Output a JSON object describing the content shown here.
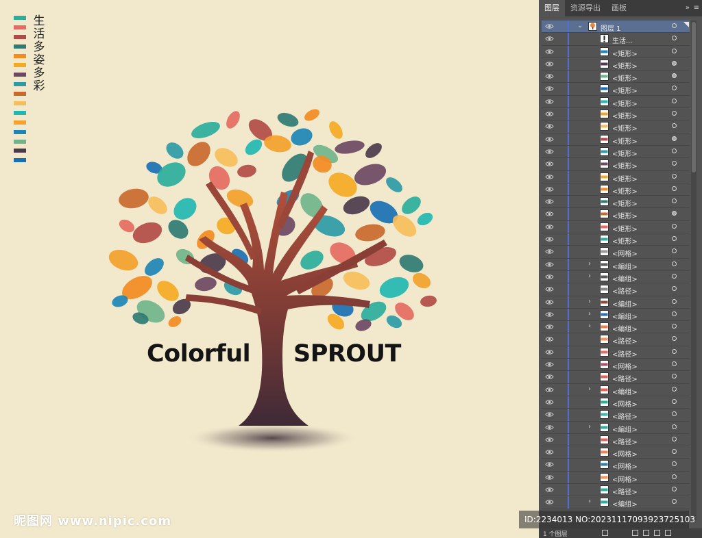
{
  "canvas": {
    "swatch_colors": [
      "#2dae9d",
      "#e56b62",
      "#b24b47",
      "#2f7b73",
      "#f38b22",
      "#f6aa24",
      "#6d4862",
      "#2d9aa5",
      "#c9692c",
      "#f6be5a",
      "#23b7b1",
      "#f4a12d",
      "#1e86b6",
      "#71b48b",
      "#4c3a4b",
      "#1a6fb3"
    ],
    "vertical_title": [
      "生",
      "活",
      "多",
      "姿",
      "多",
      "彩"
    ],
    "brand_left": "Colorful",
    "brand_right": "SPROUT",
    "watermark_left": "昵图网 www.nipic.com",
    "watermark_right": "ID:2234013 NO:20231117093923725103"
  },
  "panel": {
    "tabs": [
      "图层",
      "资源导出",
      "画板"
    ],
    "menu_chevrons": "»",
    "menu_icon": "≡",
    "rows": [
      {
        "label": "图层 1",
        "expand": "⌄",
        "thumb": "tree",
        "target_filled": false
      },
      {
        "label": "生活...",
        "expand": "",
        "thumb": "text",
        "target_filled": false
      },
      {
        "label": "<矩形>",
        "expand": "",
        "thumb": "#1e86b6",
        "target_filled": false
      },
      {
        "label": "<矩形>",
        "expand": "",
        "thumb": "#4c3a4b",
        "target_filled": true
      },
      {
        "label": "<矩形>",
        "expand": "",
        "thumb": "#71b48b",
        "target_filled": true
      },
      {
        "label": "<矩形>",
        "expand": "",
        "thumb": "#1a6fb3",
        "target_filled": false
      },
      {
        "label": "<矩形>",
        "expand": "",
        "thumb": "#23b7b1",
        "target_filled": false
      },
      {
        "label": "<矩形>",
        "expand": "",
        "thumb": "#f4a12d",
        "target_filled": false
      },
      {
        "label": "<矩形>",
        "expand": "",
        "thumb": "#f6be5a",
        "target_filled": false
      },
      {
        "label": "<矩形>",
        "expand": "",
        "thumb": "#b24b47",
        "target_filled": true
      },
      {
        "label": "<矩形>",
        "expand": "",
        "thumb": "#2d9aa5",
        "target_filled": false
      },
      {
        "label": "<矩形>",
        "expand": "",
        "thumb": "#6d4862",
        "target_filled": false
      },
      {
        "label": "<矩形>",
        "expand": "",
        "thumb": "#f6aa24",
        "target_filled": false
      },
      {
        "label": "<矩形>",
        "expand": "",
        "thumb": "#f38b22",
        "target_filled": false
      },
      {
        "label": "<矩形>",
        "expand": "",
        "thumb": "#2f7b73",
        "target_filled": false
      },
      {
        "label": "<矩形>",
        "expand": "",
        "thumb": "#c9692c",
        "target_filled": true
      },
      {
        "label": "<矩形>",
        "expand": "",
        "thumb": "#e56b62",
        "target_filled": false
      },
      {
        "label": "<矩形>",
        "expand": "",
        "thumb": "#2dae9d",
        "target_filled": false
      },
      {
        "label": "<网格>",
        "expand": "",
        "thumb": "#9a9a9a",
        "target_filled": false
      },
      {
        "label": "<编组>",
        "expand": "›",
        "thumb": "#5a5a5a",
        "target_filled": false
      },
      {
        "label": "<编组>",
        "expand": "›",
        "thumb": "#5a5a5a",
        "target_filled": false
      },
      {
        "label": "<路径>",
        "expand": "",
        "thumb": "#888888",
        "target_filled": false
      },
      {
        "label": "<编组>",
        "expand": "›",
        "thumb": "#8a4a3a",
        "target_filled": false
      },
      {
        "label": "<编组>",
        "expand": "›",
        "thumb": "#2d6fa8",
        "target_filled": false
      },
      {
        "label": "<编组>",
        "expand": "›",
        "thumb": "#ee7c52",
        "target_filled": false
      },
      {
        "label": "<路径>",
        "expand": "",
        "thumb": "#f1955a",
        "target_filled": false
      },
      {
        "label": "<路径>",
        "expand": "",
        "thumb": "#e56b62",
        "target_filled": false
      },
      {
        "label": "<网格>",
        "expand": "",
        "thumb": "#b24b6a",
        "target_filled": false
      },
      {
        "label": "<路径>",
        "expand": "",
        "thumb": "#e5605a",
        "target_filled": false
      },
      {
        "label": "<编组>",
        "expand": "›",
        "thumb": "#e5605a",
        "target_filled": false
      },
      {
        "label": "<网格>",
        "expand": "",
        "thumb": "#2dae9d",
        "target_filled": false
      },
      {
        "label": "<路径>",
        "expand": "",
        "thumb": "#40b4a6",
        "target_filled": false
      },
      {
        "label": "<编组>",
        "expand": "›",
        "thumb": "#2dae9d",
        "target_filled": false
      },
      {
        "label": "<路径>",
        "expand": "",
        "thumb": "#e5605a",
        "target_filled": false
      },
      {
        "label": "<网格>",
        "expand": "",
        "thumb": "#f0804f",
        "target_filled": false
      },
      {
        "label": "<网格>",
        "expand": "",
        "thumb": "#2a7fa8",
        "target_filled": false
      },
      {
        "label": "<网格>",
        "expand": "",
        "thumb": "#f1955a",
        "target_filled": false
      },
      {
        "label": "<路径>",
        "expand": "",
        "thumb": "#2dae9d",
        "target_filled": false
      },
      {
        "label": "<编组>",
        "expand": "›",
        "thumb": "#2dae9d",
        "target_filled": false
      }
    ],
    "footer_label": "1 个图层"
  }
}
